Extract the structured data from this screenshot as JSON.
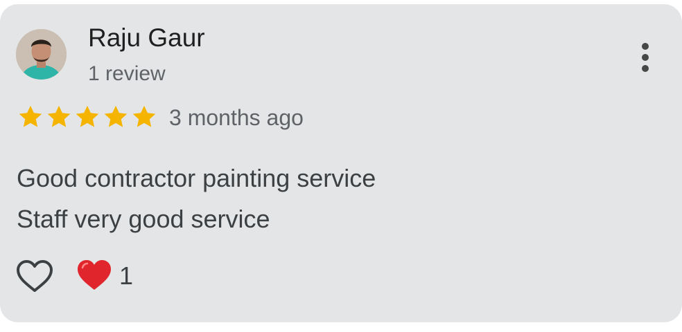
{
  "review": {
    "author": "Raju Gaur",
    "review_count": "1 review",
    "rating": 5,
    "rating_max": 5,
    "time": "3 months ago",
    "text_lines": [
      "Good contractor painting service",
      "Staff very good service"
    ],
    "reaction_count": "1"
  },
  "colors": {
    "card_bg": "#e4e5e6",
    "star": "#f4b400",
    "heart": "#e0262c",
    "text": "#3c4043",
    "muted": "#5f6368"
  },
  "icons": {
    "more": "more-vert-icon",
    "like": "heart-outline-icon",
    "reaction": "red-heart-icon",
    "star": "star-icon"
  }
}
